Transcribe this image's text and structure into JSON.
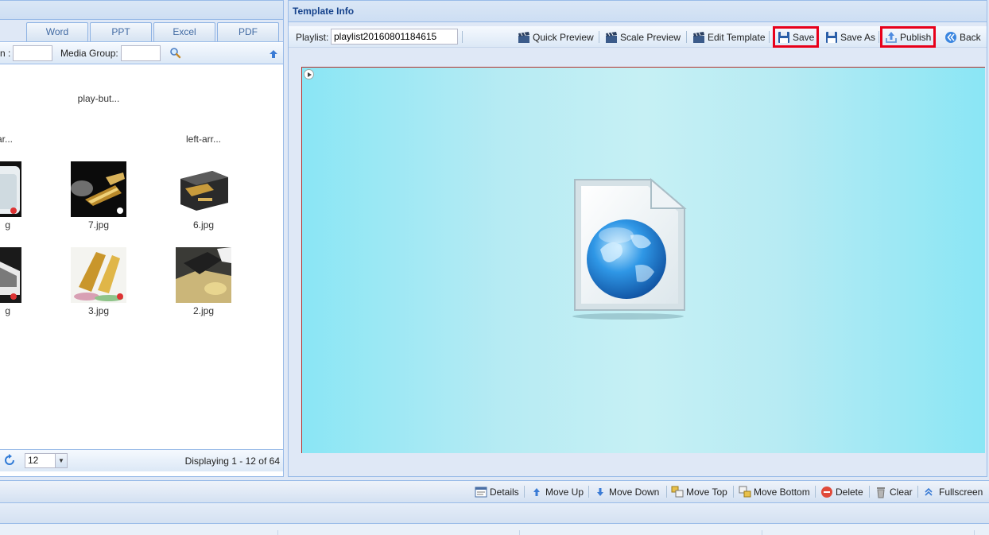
{
  "left": {
    "tabs": [
      "Word",
      "PPT",
      "Excel",
      "PDF"
    ],
    "filter_label_1": "n :",
    "filter_label_2": "Media Group:",
    "items": [
      {
        "label": "play-but..."
      },
      {
        "label": "ar..."
      },
      {
        "label": "left-arr..."
      },
      {
        "label": "g"
      },
      {
        "label": "7.jpg"
      },
      {
        "label": "6.jpg"
      },
      {
        "label": "g"
      },
      {
        "label": "3.jpg"
      },
      {
        "label": "2.jpg"
      }
    ],
    "page_size": "12",
    "display_text": "Displaying 1 - 12 of 64"
  },
  "right": {
    "title": "Template Info",
    "playlist_label": "Playlist:",
    "playlist_value": "playlist20160801184615",
    "buttons": {
      "quick_preview": "Quick Preview",
      "scale_preview": "Scale Preview",
      "edit_template": "Edit Template",
      "save": "Save",
      "save_as": "Save As",
      "publish": "Publish",
      "back": "Back"
    }
  },
  "bottom": {
    "details": "Details",
    "move_up": "Move Up",
    "move_down": "Move Down",
    "move_top": "Move Top",
    "move_bottom": "Move Bottom",
    "delete": "Delete",
    "clear": "Clear",
    "fullscreen": "Fullscreen"
  },
  "colors": {
    "highlight": "#e8001a",
    "header_text": "#15428b",
    "stage_edge": "#8ae6f5",
    "stage_center": "#c6f0f4"
  }
}
